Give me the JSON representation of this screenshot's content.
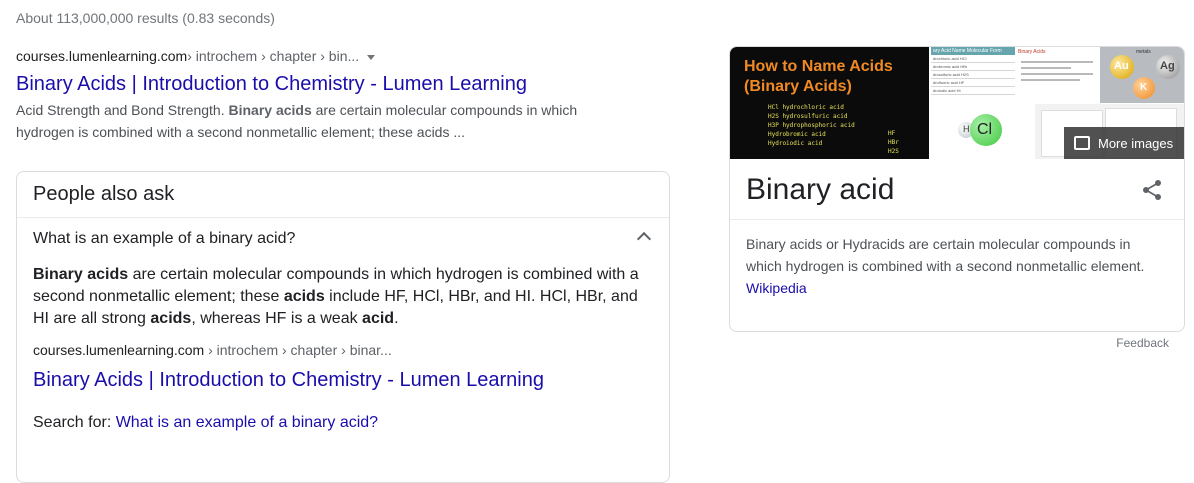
{
  "stats": "About 113,000,000 results (0.83 seconds)",
  "result": {
    "domain": "courses.lumenlearning.com",
    "path": " › introchem › chapter › bin...",
    "title": "Binary Acids | Introduction to Chemistry - Lumen Learning",
    "snippet": [
      "Acid Strength and Bond Strength. ",
      "Binary acids",
      " are certain molecular compounds in which hydrogen is combined with a second nonmetallic element; these acids ..."
    ]
  },
  "paa": {
    "heading": "People also ask",
    "question": "What is an example of a binary acid?",
    "answer": [
      "Binary acids",
      " are certain molecular compounds in which hydrogen is combined with a second nonmetallic element; these ",
      "acids",
      " include HF, HCl, HBr, and HI. HCl, HBr, and HI are all strong ",
      "acids",
      ", whereas HF is a weak ",
      "acid",
      "."
    ],
    "cite_domain": "courses.lumenlearning.com",
    "cite_path": " › introchem › chapter › binar...",
    "link_title": "Binary Acids | Introduction to Chemistry - Lumen Learning",
    "search_label": "Search for: ",
    "search_query": "What is an example of a binary acid?"
  },
  "knowledge_panel": {
    "title": "Binary acid",
    "image_caption": [
      "How to Name Acids",
      "(Binary Acids)"
    ],
    "handwriting_left": [
      "HCl   hydrochloric acid",
      "H2S   hydrosulfuric acid",
      "H3P   hydrophosphoric acid",
      "Hydrobromic acid",
      "Hydroiodic acid"
    ],
    "handwriting_right": [
      "HF",
      "HBr",
      "H2S"
    ],
    "table_header": [
      "ary Acid Name",
      "Molecular Form"
    ],
    "table_rows": [
      "drochloric acid   HCl",
      "drobromic acid   HBr",
      "drosulfuric acid   H2S",
      "drofluoric acid   HF",
      "droiodic acid   HI"
    ],
    "notes_title": "Binary Acids",
    "metals": [
      "Au",
      "Ag",
      "K"
    ],
    "metal_text": "metals",
    "molecule": [
      "H",
      "Cl"
    ],
    "more_images": "More images",
    "description": "Binary acids or Hydracids are certain molecular compounds in which hydrogen is combined with a second nonmetallic element.",
    "source": "Wikipedia"
  },
  "feedback": "Feedback",
  "colors": {
    "link": "#1a0dab",
    "accent_orange": "#f08a24",
    "border": "#dadce0"
  }
}
